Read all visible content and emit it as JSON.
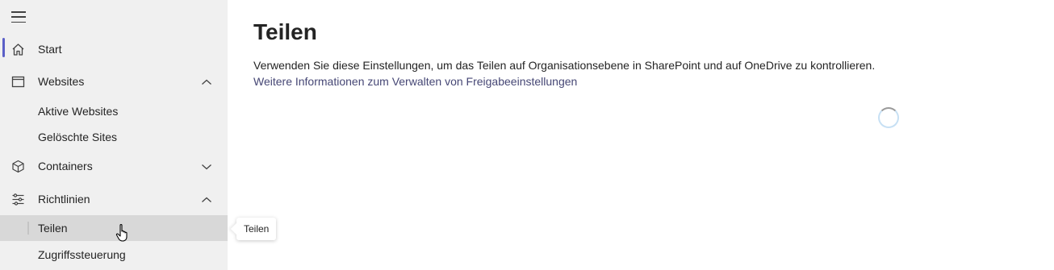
{
  "sidebar": {
    "items": [
      {
        "label": "Start",
        "icon": "home-icon"
      },
      {
        "label": "Websites",
        "icon": "browser-window-icon",
        "expanded": true
      },
      {
        "label": "Containers",
        "icon": "cube-icon",
        "expanded": false
      },
      {
        "label": "Richtlinien",
        "icon": "sliders-icon",
        "expanded": true
      }
    ],
    "websites_children": [
      "Aktive Websites",
      "Gelöschte Sites"
    ],
    "richtlinien_children": [
      "Teilen",
      "Zugriffssteuerung"
    ],
    "selected": "Teilen"
  },
  "main": {
    "title": "Teilen",
    "description": "Verwenden Sie diese Einstellungen, um das Teilen auf Organisationsebene in SharePoint und auf OneDrive zu kontrollieren.",
    "link": "Weitere Informationen zum Verwalten von Freigabeeinstellungen",
    "loading": true
  },
  "tooltip": {
    "text": "Teilen"
  },
  "colors": {
    "accent": "#5b5fc7",
    "sidebar_bg": "#f0f0f0",
    "selected_bg": "#d8d8d8",
    "link": "#464775"
  }
}
